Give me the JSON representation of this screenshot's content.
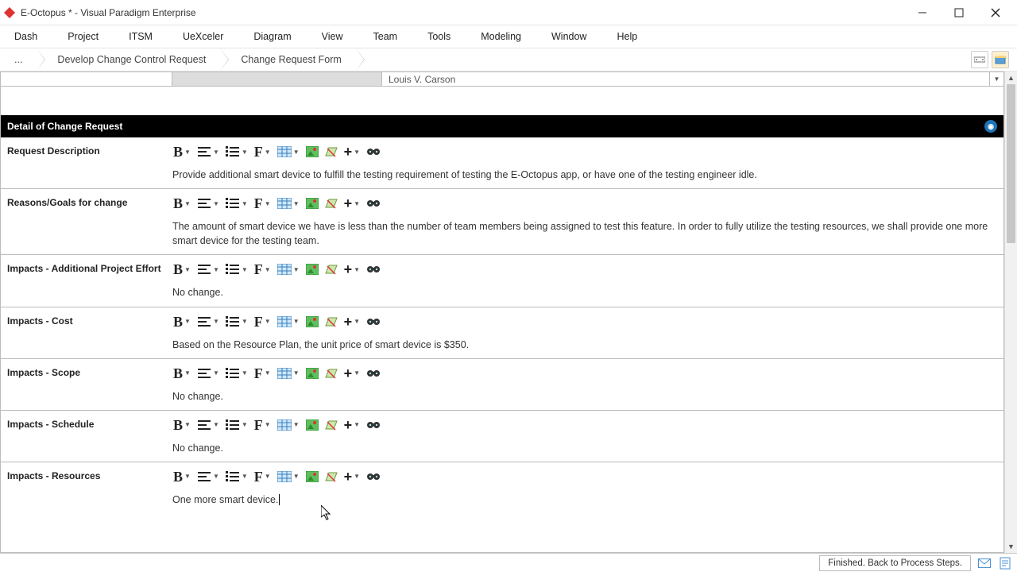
{
  "window": {
    "title": "E-Octopus * - Visual Paradigm Enterprise"
  },
  "menu": {
    "items": [
      "Dash",
      "Project",
      "ITSM",
      "UeXceler",
      "Diagram",
      "View",
      "Team",
      "Tools",
      "Modeling",
      "Window",
      "Help"
    ]
  },
  "breadcrumbs": {
    "items": [
      "...",
      "Develop Change Control Request",
      "Change Request Form"
    ]
  },
  "top_cell": {
    "value": "Louis V. Carson"
  },
  "section": {
    "title": "Detail of Change Request"
  },
  "fields": [
    {
      "label": "Request Description",
      "text": "Provide additional smart device to fulfill the testing requirement of testing the E-Octopus app, or have one of the testing engineer idle."
    },
    {
      "label": "Reasons/Goals for change",
      "text": "The amount of smart device we have is less than the number of team members being assigned to test this feature. In order to fully utilize the testing resources, we shall provide one more smart device for the testing team."
    },
    {
      "label": "Impacts - Additional Project Effort",
      "text": "No change."
    },
    {
      "label": "Impacts - Cost",
      "text": "Based on the Resource Plan, the unit price of smart device is $350."
    },
    {
      "label": "Impacts - Scope",
      "text": "No change."
    },
    {
      "label": "Impacts - Schedule",
      "text": "No change."
    },
    {
      "label": "Impacts - Resources",
      "text": "One more smart device."
    }
  ],
  "status": {
    "text": "Finished. Back to Process Steps."
  },
  "toolbar_icons": {
    "bold": "B",
    "align": "align",
    "list": "list",
    "font": "F",
    "table": "table",
    "image": "image",
    "clear": "eraser",
    "add": "+",
    "find": "binoculars"
  }
}
